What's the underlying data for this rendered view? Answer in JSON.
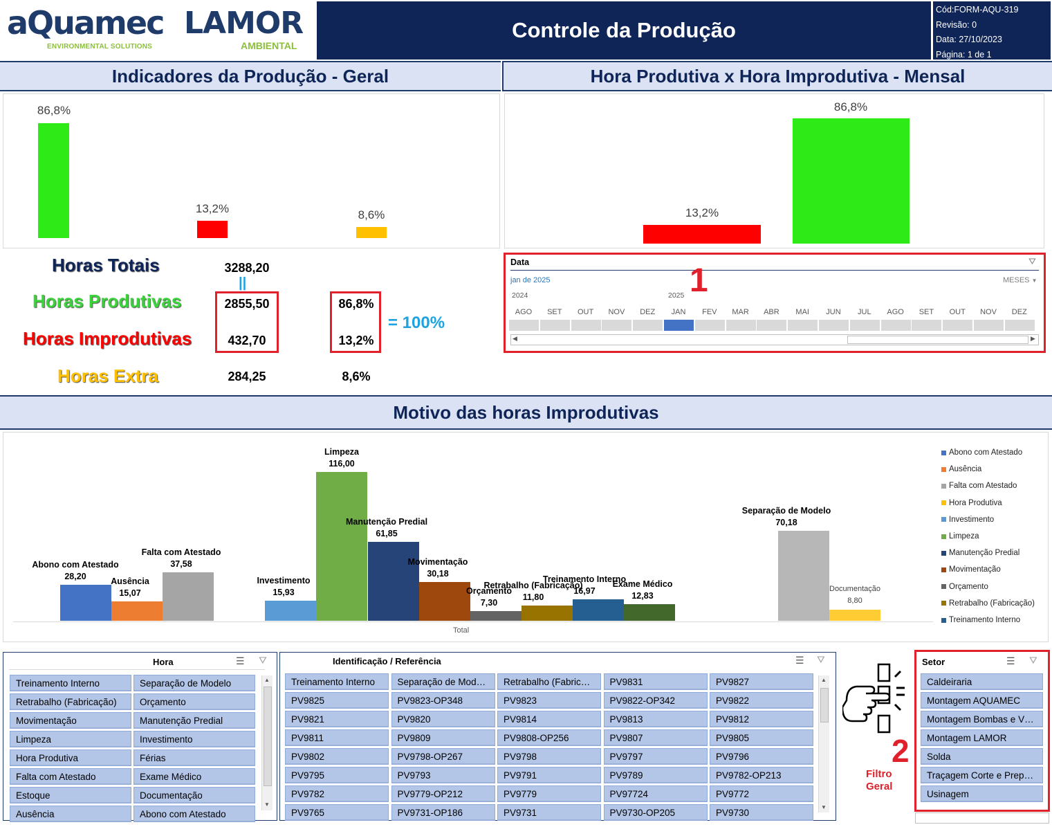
{
  "header": {
    "logo1_main": "aQuamec",
    "logo1_sub": "ENVIRONMENTAL SOLUTIONS",
    "logo2_main": "LAMOR",
    "logo2_sub": "AMBIENTAL",
    "title": "Controle da Produção",
    "info": [
      "Cód:FORM-AQU-319",
      "Revisão: 0",
      "Data: 27/10/2023",
      "Página: 1 de 1"
    ]
  },
  "sections": {
    "geral": "Indicadores da Produção - Geral",
    "mensal": "Hora Produtiva x Hora Improdutiva - Mensal",
    "motivo": "Motivo das horas Improdutivas"
  },
  "geral_chart": {
    "labels": [
      "86,8%",
      "13,2%",
      "8,6%"
    ],
    "values": [
      86.8,
      13.2,
      8.6
    ],
    "colors": [
      "#2eea16",
      "#ff0000",
      "#ffc000"
    ]
  },
  "mensal_chart": {
    "labels": [
      "13,2%",
      "86,8%"
    ],
    "values": [
      13.2,
      86.8
    ],
    "colors": [
      "#ff0000",
      "#2eea16"
    ]
  },
  "kpis": {
    "totais_label": "Horas Totais",
    "totais_val": "3288,20",
    "equals_glyph": "||",
    "prod_label": "Horas Produtivas",
    "prod_val": "2855,50",
    "prod_pct": "86,8%",
    "improd_label": "Horas Improdutivas",
    "improd_val": "432,70",
    "improd_pct": "13,2%",
    "sum_text": "= 100%",
    "extra_label": "Horas Extra",
    "extra_val": "284,25",
    "extra_pct": "8,6%"
  },
  "timeline": {
    "title": "Data",
    "selected": "jan de 2025",
    "level": "MESES",
    "marker": "1",
    "years": [
      "2024",
      "2025"
    ],
    "months": [
      "AGO",
      "SET",
      "OUT",
      "NOV",
      "DEZ",
      "JAN",
      "FEV",
      "MAR",
      "ABR",
      "MAI",
      "JUN",
      "JUL",
      "AGO",
      "SET",
      "OUT",
      "NOV",
      "DEZ"
    ],
    "selected_index": 5
  },
  "chart_data": {
    "type": "bar",
    "xlabel": "Total",
    "categories": [
      "Abono com Atestado",
      "Ausência",
      "Falta com Atestado",
      "Investimento",
      "Limpeza",
      "Manutenção Predial",
      "Movimentação",
      "Orçamento",
      "Retrabalho (Fabricação)",
      "Treinamento Interno",
      "Exame Médico",
      "Separação de Modelo",
      "Documentação"
    ],
    "values": [
      28.2,
      15.07,
      37.58,
      15.93,
      116.0,
      61.85,
      30.18,
      7.3,
      11.8,
      16.97,
      12.83,
      70.18,
      8.8
    ],
    "value_labels": [
      "28,20",
      "15,07",
      "37,58",
      "15,93",
      "116,00",
      "61,85",
      "30,18",
      "7,30",
      "11,80",
      "16,97",
      "12,83",
      "70,18",
      "8,80"
    ],
    "colors": [
      "#4472c4",
      "#ed7d31",
      "#a5a5a5",
      "#5b9bd5",
      "#70ad47",
      "#264478",
      "#9e480e",
      "#636363",
      "#997300",
      "#255e91",
      "#43682b",
      "#b7b7b7",
      "#ffcd33"
    ],
    "legend": [
      "Abono com Atestado",
      "Ausência",
      "Falta com Atestado",
      "Hora Produtiva",
      "Investimento",
      "Limpeza",
      "Manutenção Predial",
      "Movimentação",
      "Orçamento",
      "Retrabalho (Fabricação)",
      "Treinamento Interno"
    ],
    "legend_colors": [
      "#4472c4",
      "#ed7d31",
      "#a5a5a5",
      "#ffc000",
      "#5b9bd5",
      "#70ad47",
      "#264478",
      "#9e480e",
      "#636363",
      "#997300",
      "#255e91"
    ]
  },
  "slicer_hora": {
    "title": "Hora",
    "items": [
      "Treinamento Interno",
      "Separação de Modelo",
      "Retrabalho (Fabricação)",
      "Orçamento",
      "Movimentação",
      "Manutenção Predial",
      "Limpeza",
      "Investimento",
      "Hora Produtiva",
      "Férias",
      "Falta com Atestado",
      "Exame Médico",
      "Estoque",
      "Documentação",
      "Ausência",
      "Abono com Atestado"
    ]
  },
  "slicer_ident": {
    "title": "Identificação / Referência",
    "items": [
      "Treinamento Interno",
      "Separação de Modelo",
      "Retrabalho (Fabricaç...",
      "PV9831",
      "PV9827",
      "PV9825",
      "PV9823-OP348",
      "PV9823",
      "PV9822-OP342",
      "PV9822",
      "PV9821",
      "PV9820",
      "PV9814",
      "PV9813",
      "PV9812",
      "PV9811",
      "PV9809",
      "PV9808-OP256",
      "PV9807",
      "PV9805",
      "PV9802",
      "PV9798-OP267",
      "PV9798",
      "PV9797",
      "PV9796",
      "PV9795",
      "PV9793",
      "PV9791",
      "PV9789",
      "PV9782-OP213",
      "PV9782",
      "PV9779-OP212",
      "PV9779",
      "PV97724",
      "PV9772",
      "PV9765",
      "PV9731-OP186",
      "PV9731",
      "PV9730-OP205",
      "PV9730"
    ]
  },
  "filtro": {
    "marker": "2",
    "label_line1": "Filtro",
    "label_line2": "Geral"
  },
  "slicer_setor": {
    "title": "Setor",
    "items": [
      "Caldeiraria",
      "Montagem AQUAMEC",
      "Montagem Bombas e Vá...",
      "Montagem LAMOR",
      "Solda",
      "Traçagem Corte e Prepa...",
      "Usinagem"
    ]
  }
}
